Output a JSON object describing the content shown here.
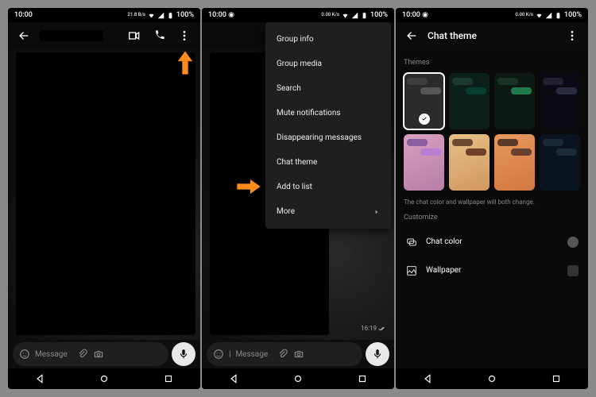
{
  "status": {
    "time": "10:00",
    "net_speed": "21.8 B/s",
    "net_speed_alt": "0.00 K/s",
    "battery": "100%"
  },
  "screen1": {
    "input_placeholder": "Message"
  },
  "screen2": {
    "input_placeholder": "Message",
    "timestamp": "16:19",
    "menu": [
      "Group info",
      "Group media",
      "Search",
      "Mute notifications",
      "Disappearing messages",
      "Chat theme",
      "Add to list",
      "More"
    ]
  },
  "screen3": {
    "title": "Chat theme",
    "section_themes": "Themes",
    "hint": "The chat color and wallpaper will both change.",
    "section_customize": "Customize",
    "row_color": "Chat color",
    "row_wallpaper": "Wallpaper",
    "themes": [
      {
        "bg": "#2b2b2b",
        "in": "#3d3d3d",
        "out": "#555",
        "selected": true
      },
      {
        "bg": "#0d1f1a",
        "in": "#1a3a30",
        "out": "#083e30",
        "selected": false
      },
      {
        "bg": "#0d1a14",
        "in": "#1b3324",
        "out": "#1e7a4a",
        "selected": false
      },
      {
        "bg": "#0a0a14",
        "in": "#222233",
        "out": "#2a2a3f",
        "selected": false
      },
      {
        "bg": "linear-gradient(160deg,#d9a0c0,#b77fa8)",
        "in": "#8a5e9e",
        "out": "#b77fd1",
        "selected": false
      },
      {
        "bg": "linear-gradient(160deg,#e8c088,#d09860)",
        "in": "#6b4a30",
        "out": "#704028",
        "selected": false
      },
      {
        "bg": "linear-gradient(160deg,#e89860,#d07840)",
        "in": "#5a3a28",
        "out": "#6a4030",
        "selected": false
      },
      {
        "bg": "#0a141f",
        "in": "#1a2a38",
        "out": "#1a2a38",
        "selected": false
      }
    ]
  },
  "arrow_color": "#ff8c1a"
}
